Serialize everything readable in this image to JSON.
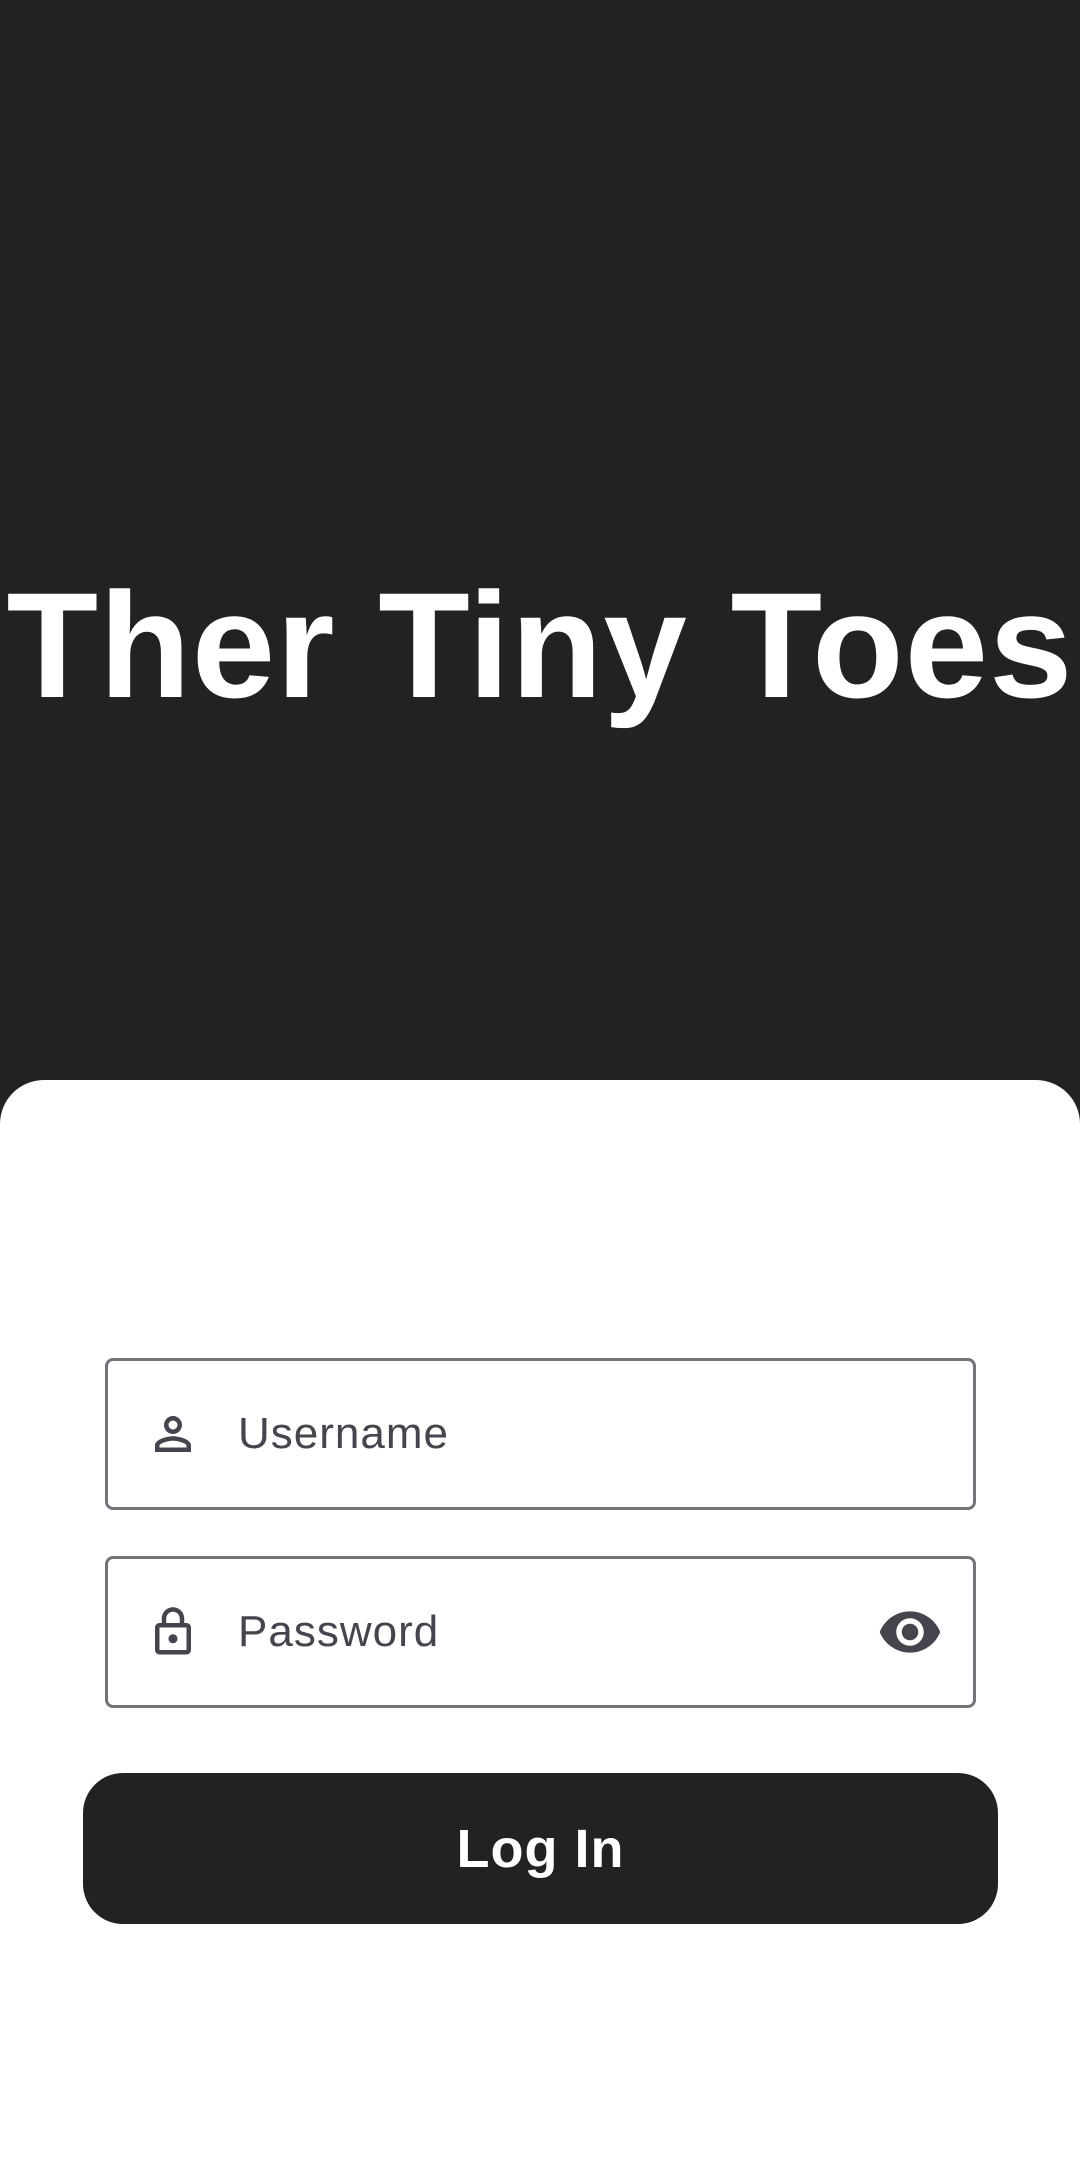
{
  "app": {
    "title": "Ther Tiny Toes"
  },
  "login_form": {
    "username": {
      "placeholder": "Username",
      "value": "",
      "icon": "person-icon"
    },
    "password": {
      "placeholder": "Password",
      "value": "",
      "icon": "lock-icon",
      "toggle_icon": "eye-icon"
    },
    "submit_label": "Log In"
  },
  "colors": {
    "header_background": "#222222",
    "sheet_background": "#ffffff",
    "field_border": "#75737a",
    "field_text": "#46444c",
    "button_background": "#222222",
    "button_text": "#ffffff"
  }
}
